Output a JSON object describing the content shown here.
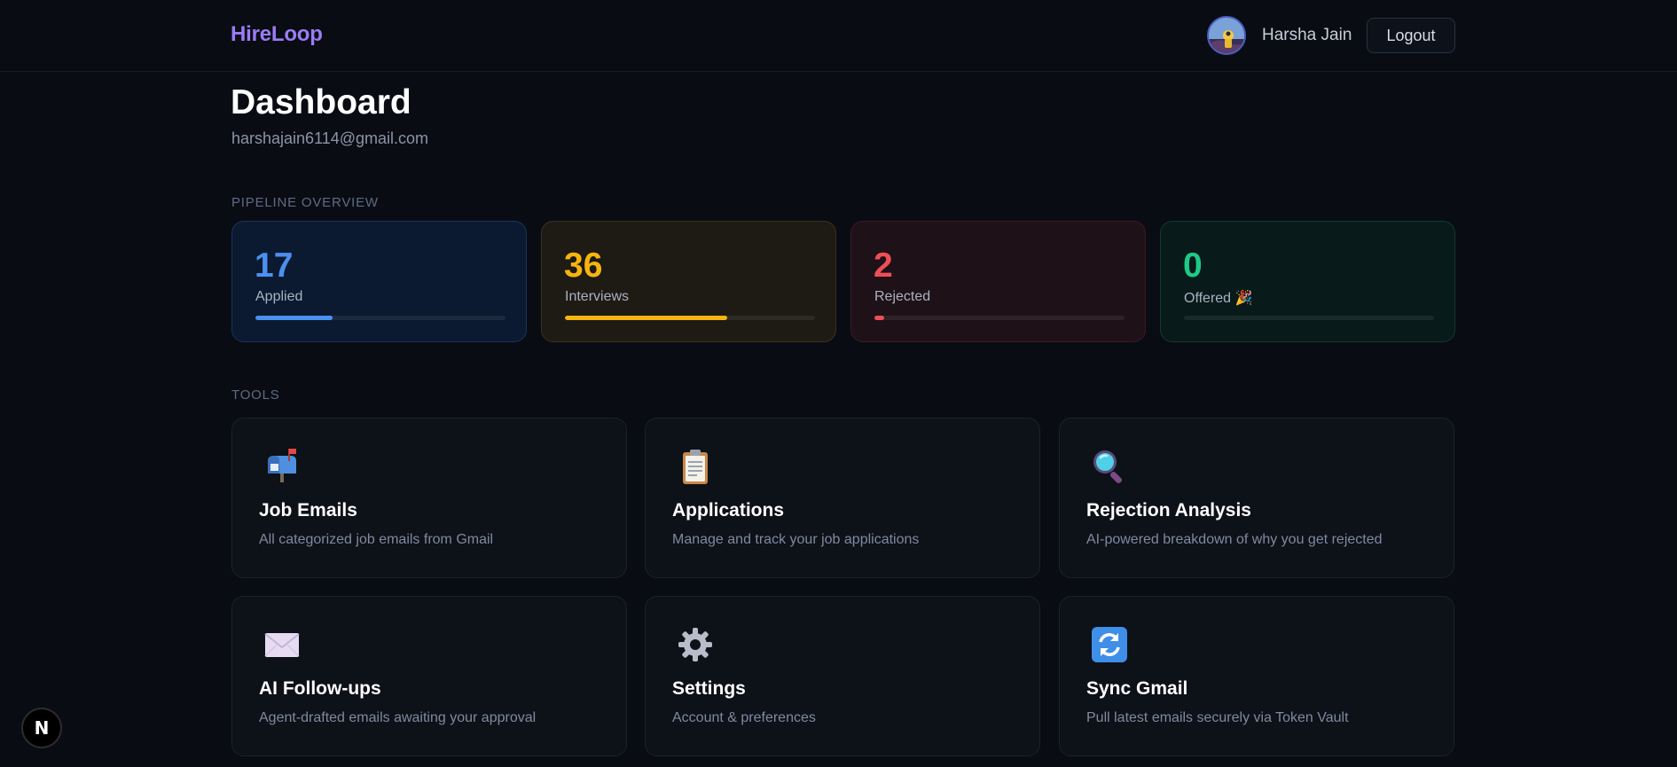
{
  "header": {
    "brand": "HireLoop",
    "user_name": "Harsha Jain",
    "logout_label": "Logout",
    "avatar_icon": "user-avatar-icon"
  },
  "page": {
    "title": "Dashboard",
    "email": "harshajain6114@gmail.com"
  },
  "pipeline": {
    "section_label": "PIPELINE OVERVIEW",
    "stats": [
      {
        "value": "17",
        "label": "Applied",
        "progress": 0.31,
        "color": "#4a90f0"
      },
      {
        "value": "36",
        "label": "Interviews",
        "progress": 0.65,
        "color": "#f5b50f"
      },
      {
        "value": "2",
        "label": "Rejected",
        "progress": 0.04,
        "color": "#ee4f57"
      },
      {
        "value": "0",
        "label": "Offered 🎉",
        "progress": 0.0,
        "color": "#1fc986"
      }
    ]
  },
  "tools": {
    "section_label": "TOOLS",
    "items": [
      {
        "icon": "mailbox-icon",
        "title": "Job Emails",
        "description": "All categorized job emails from Gmail"
      },
      {
        "icon": "clipboard-icon",
        "title": "Applications",
        "description": "Manage and track your job applications"
      },
      {
        "icon": "magnifier-icon",
        "title": "Rejection Analysis",
        "description": "AI-powered breakdown of why you get rejected"
      },
      {
        "icon": "envelope-icon",
        "title": "AI Follow-ups",
        "description": "Agent-drafted emails awaiting your approval"
      },
      {
        "icon": "gear-icon",
        "title": "Settings",
        "description": "Account & preferences"
      },
      {
        "icon": "sync-icon",
        "title": "Sync Gmail",
        "description": "Pull latest emails securely via Token Vault"
      }
    ]
  },
  "dev_badge": {
    "label": "N"
  }
}
